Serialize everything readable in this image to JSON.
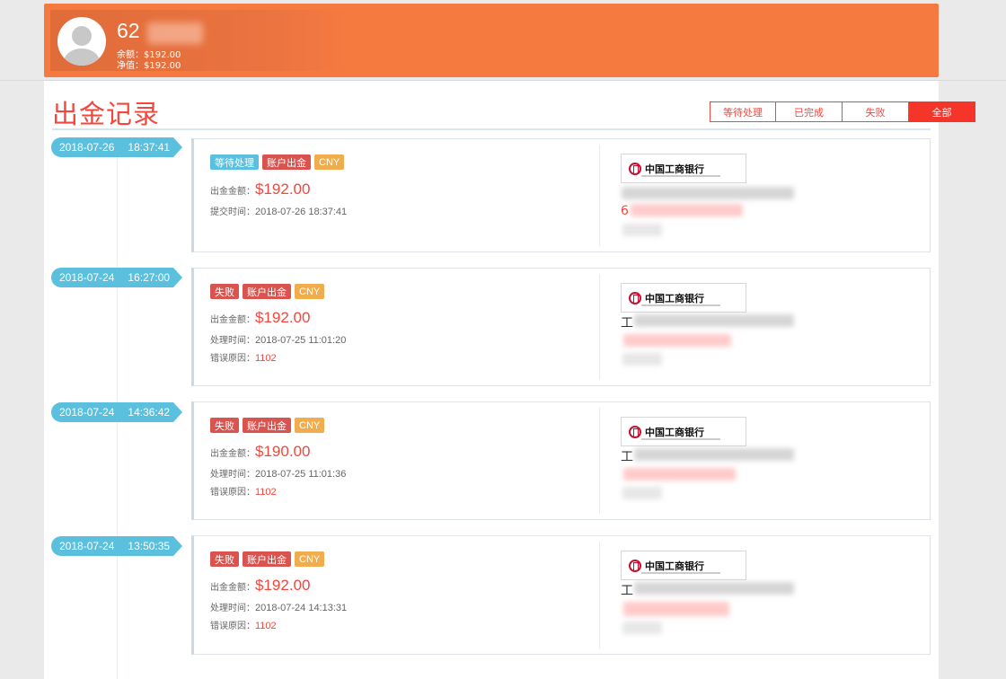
{
  "account": {
    "name": "62",
    "balance": "余额：$192.00",
    "net_value": "净值：$192.00"
  },
  "page": {
    "title": "出金记录"
  },
  "filters": [
    {
      "label": "等待处理",
      "active": false
    },
    {
      "label": "已完成",
      "active": false
    },
    {
      "label": "失败",
      "active": false
    },
    {
      "label": "全部",
      "active": true
    }
  ],
  "labels": {
    "amount": "出金金额：",
    "submit_time": "提交时间：",
    "process_time": "处理时间：",
    "error_reason": "错误原因："
  },
  "records": [
    {
      "date": "2018-07-26",
      "time": "18:37:41",
      "status": "等待处理",
      "type": "账户出金",
      "currency": "CNY",
      "amount": "$192.00",
      "time_value": "2018-07-26 18:37:41",
      "bank": "中国工商银行",
      "prefix": "6"
    },
    {
      "date": "2018-07-24",
      "time": "16:27:00",
      "status": "失败",
      "type": "账户出金",
      "currency": "CNY",
      "amount": "$192.00",
      "time_value": "2018-07-25 11:01:20",
      "error": "1102",
      "bank": "中国工商银行",
      "prefix": "工"
    },
    {
      "date": "2018-07-24",
      "time": "14:36:42",
      "status": "失败",
      "type": "账户出金",
      "currency": "CNY",
      "amount": "$190.00",
      "time_value": "2018-07-25 11:01:36",
      "error": "1102",
      "bank": "中国工商银行",
      "prefix": "工"
    },
    {
      "date": "2018-07-24",
      "time": "13:50:35",
      "status": "失败",
      "type": "账户出金",
      "currency": "CNY",
      "amount": "$192.00",
      "time_value": "2018-07-24 14:13:31",
      "error": "1102",
      "bank": "中国工商银行",
      "prefix": "工"
    }
  ],
  "colors": {
    "header": "#f57a40",
    "accent_red": "#f2473d",
    "pending_badge": "#5bc0de",
    "fail_badge": "#d9534f",
    "currency_badge": "#f0ad4e"
  }
}
